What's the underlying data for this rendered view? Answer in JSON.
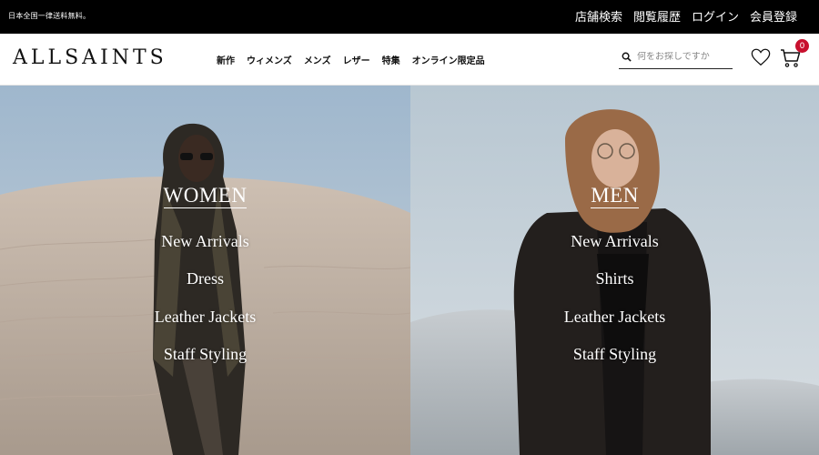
{
  "topbar": {
    "promo": "日本全国一律送料無料。",
    "links": [
      "店舗検索",
      "閲覧履歴",
      "ログイン",
      "会員登録"
    ]
  },
  "header": {
    "logo": "ALLSAINTS",
    "nav": [
      "新作",
      "ウィメンズ",
      "メンズ",
      "レザー",
      "特集",
      "オンライン限定品"
    ],
    "search": {
      "placeholder": "何をお探しですか"
    },
    "cart_count": "0"
  },
  "colors": {
    "badge": "#c8102e",
    "topbar": "#000000"
  },
  "hero": {
    "women": {
      "title": "WOMEN",
      "links": [
        "New Arrivals",
        "Dress",
        "Leather Jackets",
        "Staff Styling"
      ]
    },
    "men": {
      "title": "MEN",
      "links": [
        "New Arrivals",
        "Shirts",
        "Leather Jackets",
        "Staff Styling"
      ]
    }
  }
}
